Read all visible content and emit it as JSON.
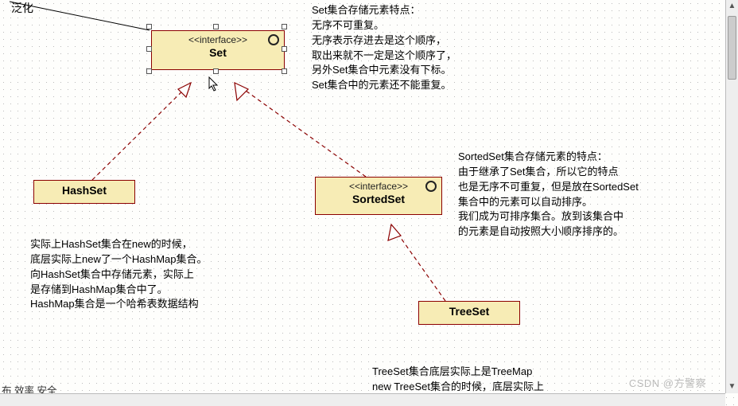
{
  "top_label": "泛化",
  "entities": {
    "set": {
      "stereotype": "<<interface>>",
      "name": "Set",
      "note": "Set集合存储元素特点：\n无序不可重复。\n无序表示存进去是这个顺序，\n取出来就不一定是这个顺序了，\n另外Set集合中元素没有下标。\nSet集合中的元素还不能重复。"
    },
    "hashset": {
      "name": "HashSet",
      "note": "实际上HashSet集合在new的时候，\n底层实际上new了一个HashMap集合。\n向HashSet集合中存储元素，实际上\n是存储到HashMap集合中了。\nHashMap集合是一个哈希表数据结构"
    },
    "sortedset": {
      "stereotype": "<<interface>>",
      "name": "SortedSet",
      "note": "SortedSet集合存储元素的特点：\n由于继承了Set集合，所以它的特点\n也是无序不可重复，但是放在SortedSet\n集合中的元素可以自动排序。\n我们成为可排序集合。放到该集合中\n的元素是自动按照大小顺序排序的。"
    },
    "treeset": {
      "name": "TreeSet",
      "note": "TreeSet集合底层实际上是TreeMap\nnew TreeSet集合的时候，底层实际上"
    }
  },
  "left_labels": "布\n效率\n安全",
  "watermark": "CSDN @方警察"
}
